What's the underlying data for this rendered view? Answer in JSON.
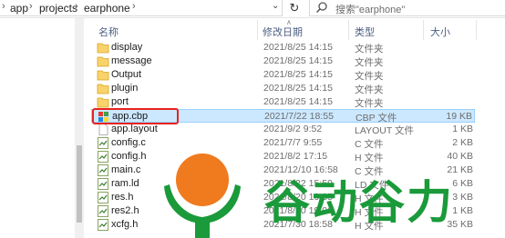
{
  "address_bar": {
    "crumbs": [
      "app",
      "projects",
      "earphone"
    ],
    "refresh_icon": "refresh-icon"
  },
  "search": {
    "placeholder": "搜索\"earphone\""
  },
  "columns": {
    "name": "名称",
    "date": "修改日期",
    "type": "类型",
    "size": "大小"
  },
  "files": [
    {
      "name": "display",
      "date": "2021/8/25 14:15",
      "type": "文件夹",
      "size": "",
      "icon": "folder-icon"
    },
    {
      "name": "message",
      "date": "2021/8/25 14:15",
      "type": "文件夹",
      "size": "",
      "icon": "folder-icon"
    },
    {
      "name": "Output",
      "date": "2021/8/25 14:15",
      "type": "文件夹",
      "size": "",
      "icon": "folder-icon"
    },
    {
      "name": "plugin",
      "date": "2021/8/25 14:15",
      "type": "文件夹",
      "size": "",
      "icon": "folder-icon"
    },
    {
      "name": "port",
      "date": "2021/8/25 14:15",
      "type": "文件夹",
      "size": "",
      "icon": "folder-icon"
    },
    {
      "name": "app.cbp",
      "date": "2021/7/22 18:55",
      "type": "CBP 文件",
      "size": "19 KB",
      "icon": "cbp-file-icon"
    },
    {
      "name": "app.layout",
      "date": "2021/9/2 9:52",
      "type": "LAYOUT 文件",
      "size": "1 KB",
      "icon": "blank-file-icon"
    },
    {
      "name": "config.c",
      "date": "2021/7/7 9:55",
      "type": "C 文件",
      "size": "2 KB",
      "icon": "code-file-icon"
    },
    {
      "name": "config.h",
      "date": "2021/8/2 17:15",
      "type": "H 文件",
      "size": "40 KB",
      "icon": "code-file-icon"
    },
    {
      "name": "main.c",
      "date": "2021/12/10 16:58",
      "type": "C 文件",
      "size": "21 KB",
      "icon": "code-file-icon"
    },
    {
      "name": "ram.ld",
      "date": "2021/8/22 15:59",
      "type": "LD 文件",
      "size": "6 KB",
      "icon": "code-file-icon"
    },
    {
      "name": "res.h",
      "date": "2021/8/20 19:35",
      "type": "H 文件",
      "size": "3 KB",
      "icon": "code-file-icon"
    },
    {
      "name": "res2.h",
      "date": "2021/8/20 19:06",
      "type": "H 文件",
      "size": "1 KB",
      "icon": "code-file-icon"
    },
    {
      "name": "xcfg.h",
      "date": "2021/7/30 18:58",
      "type": "H 文件",
      "size": "35 KB",
      "icon": "code-file-icon"
    }
  ],
  "watermark": {
    "text": "谷动谷力"
  },
  "colors": {
    "selection": "#cce8ff",
    "highlight": "#e8231b",
    "watermark_green": "#1a9a3a",
    "watermark_orange": "#f07a1e"
  }
}
